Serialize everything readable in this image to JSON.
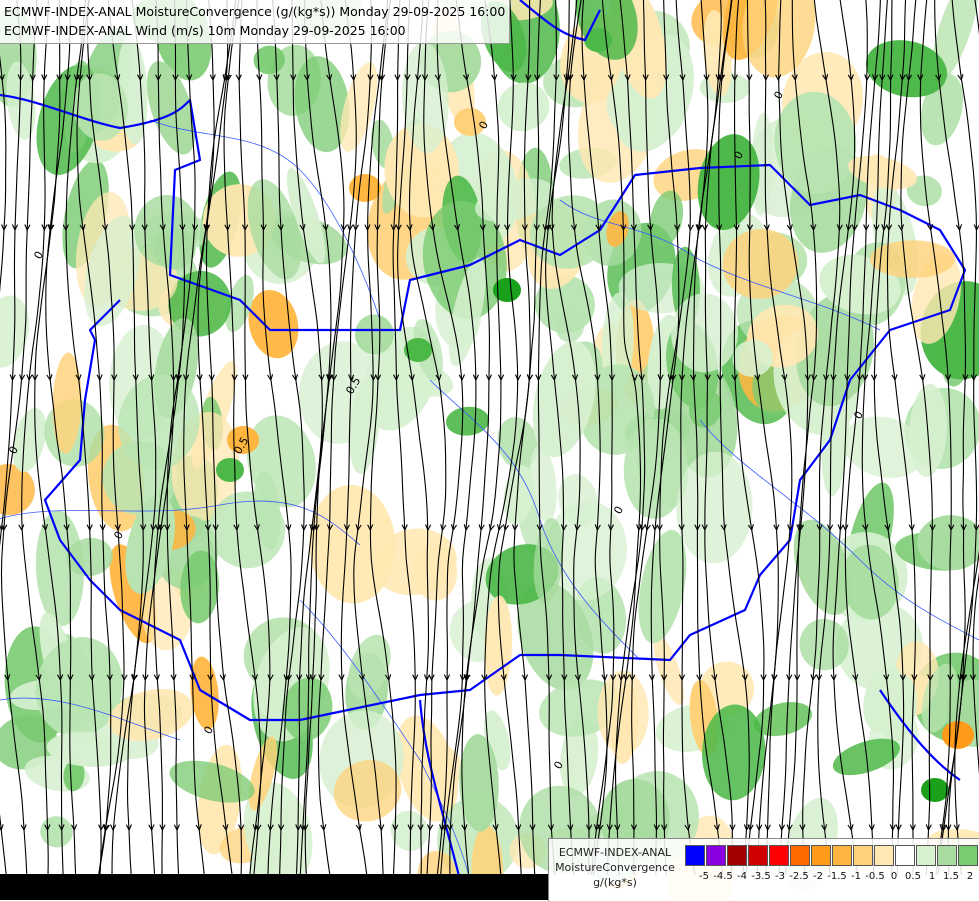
{
  "titles": {
    "line1": "ECMWF-INDEX-ANAL MoistureConvergence (g/(kg*s)) Monday 29-09-2025 16:00",
    "line2": "ECMWF-INDEX-ANAL Wind (m/s) 10m Monday 29-09-2025 16:00"
  },
  "map": {
    "border_color": "#0000ff",
    "river_color": "#3a5bff",
    "streamline_color": "#000000",
    "contour_labels": [
      "0",
      "0",
      "0",
      "0",
      "0",
      "0",
      "0",
      "0.5",
      "0.5",
      "0",
      "0",
      "0"
    ]
  },
  "legend": {
    "line1": "ECMWF-INDEX-ANAL",
    "line2": "MoistureConvergence",
    "unit": "g/(kg*s)",
    "colors": [
      "#0000ff",
      "#8a00e0",
      "#a00000",
      "#d00000",
      "#ff0000",
      "#ff6a00",
      "#ff9a1a",
      "#ffb640",
      "#ffd27a",
      "#ffe8b3",
      "#ffffff",
      "#d6f0d0",
      "#a8dca0",
      "#7acb72",
      "#4cb848",
      "#1aa01a"
    ],
    "ticks": [
      "-5",
      "-4.5",
      "-4",
      "-3.5",
      "-3",
      "-2.5",
      "-2",
      "-1.5",
      "-1",
      "-0.5",
      "0",
      "0.5",
      "1",
      "1.5",
      "2"
    ]
  }
}
